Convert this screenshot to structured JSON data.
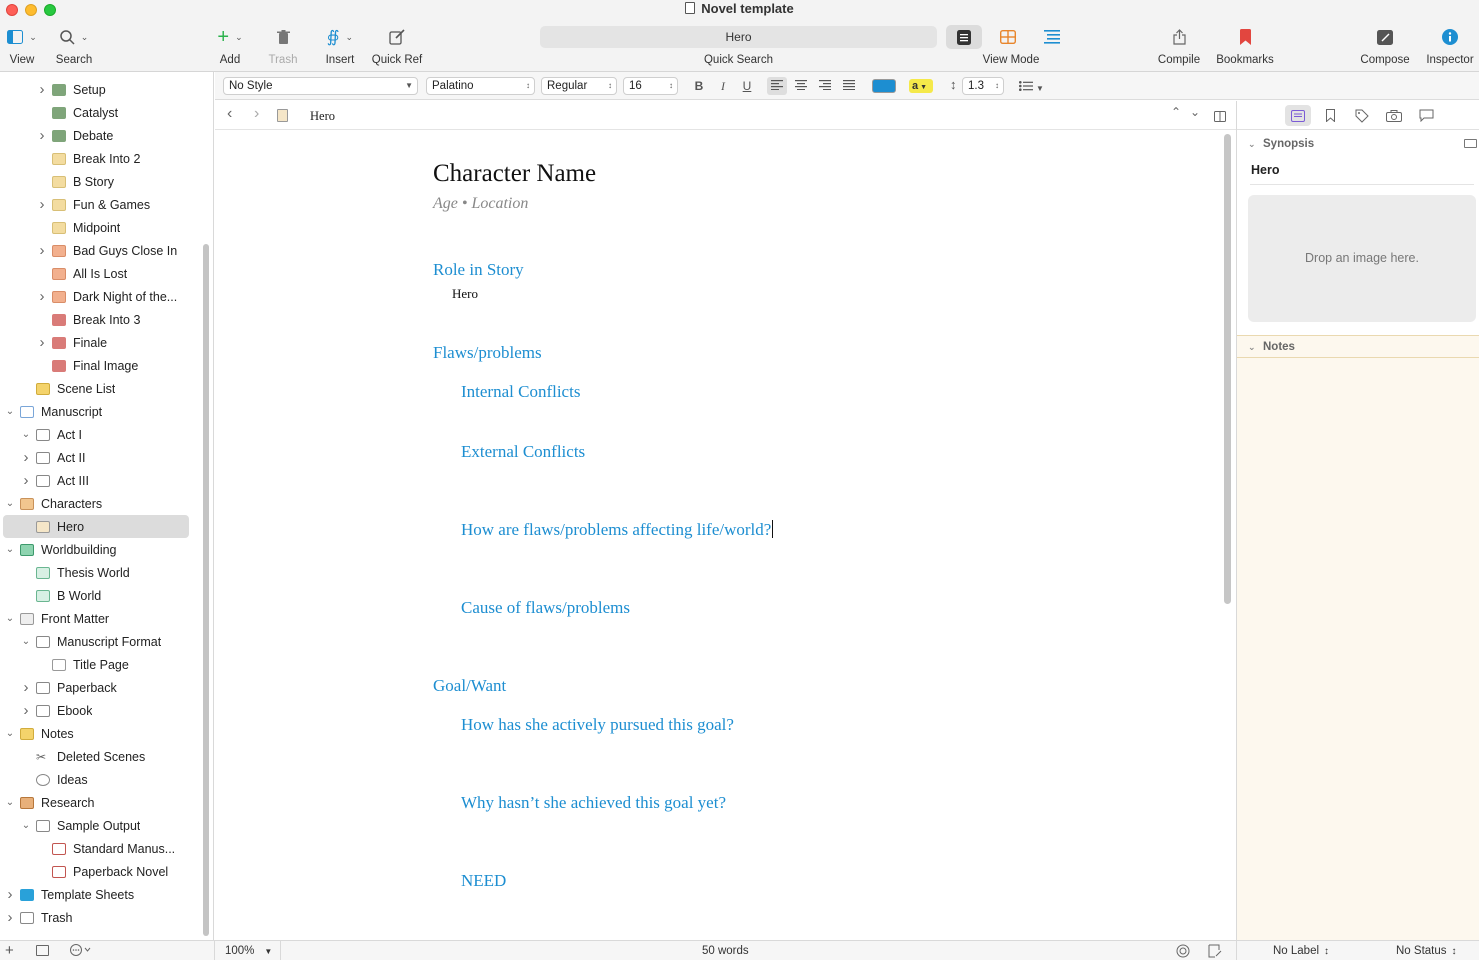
{
  "window": {
    "title": "Novel template"
  },
  "toolbar": {
    "view": "View",
    "search": "Search",
    "add": "Add",
    "trash": "Trash",
    "insert": "Insert",
    "quick_ref": "Quick Ref",
    "quick_search_value": "Hero",
    "quick_search_label": "Quick Search",
    "view_mode": "View Mode",
    "compile": "Compile",
    "bookmarks": "Bookmarks",
    "compose": "Compose",
    "inspector": "Inspector"
  },
  "binder": {
    "items": [
      {
        "label": "Setup",
        "has_children": true,
        "expanded": false
      },
      {
        "label": "Catalyst",
        "has_children": false
      },
      {
        "label": "Debate",
        "has_children": true,
        "expanded": false
      },
      {
        "label": "Break Into 2",
        "has_children": false
      },
      {
        "label": "B Story",
        "has_children": false
      },
      {
        "label": "Fun & Games",
        "has_children": true,
        "expanded": false
      },
      {
        "label": "Midpoint",
        "has_children": false
      },
      {
        "label": "Bad Guys Close In",
        "has_children": true,
        "expanded": false
      },
      {
        "label": "All Is Lost",
        "has_children": false
      },
      {
        "label": "Dark Night of the...",
        "has_children": true,
        "expanded": false
      },
      {
        "label": "Break Into 3",
        "has_children": false
      },
      {
        "label": "Finale",
        "has_children": true,
        "expanded": false
      },
      {
        "label": "Final Image",
        "has_children": false
      },
      {
        "label": "Scene List",
        "has_children": false
      },
      {
        "label": "Manuscript",
        "has_children": true,
        "expanded": true
      },
      {
        "label": "Act I",
        "has_children": true,
        "expanded": true
      },
      {
        "label": "Act II",
        "has_children": true,
        "expanded": false
      },
      {
        "label": "Act III",
        "has_children": true,
        "expanded": false
      },
      {
        "label": "Characters",
        "has_children": true,
        "expanded": true
      },
      {
        "label": "Hero",
        "has_children": false,
        "selected": true
      },
      {
        "label": "Worldbuilding",
        "has_children": true,
        "expanded": true
      },
      {
        "label": "Thesis World",
        "has_children": false
      },
      {
        "label": "B World",
        "has_children": false
      },
      {
        "label": "Front Matter",
        "has_children": true,
        "expanded": true
      },
      {
        "label": "Manuscript Format",
        "has_children": true,
        "expanded": true
      },
      {
        "label": "Title Page",
        "has_children": false
      },
      {
        "label": "Paperback",
        "has_children": true,
        "expanded": false
      },
      {
        "label": "Ebook",
        "has_children": true,
        "expanded": false
      },
      {
        "label": "Notes",
        "has_children": true,
        "expanded": true
      },
      {
        "label": "Deleted Scenes",
        "has_children": false
      },
      {
        "label": "Ideas",
        "has_children": false
      },
      {
        "label": "Research",
        "has_children": true,
        "expanded": true
      },
      {
        "label": "Sample Output",
        "has_children": true,
        "expanded": true
      },
      {
        "label": "Standard Manus...",
        "has_children": false
      },
      {
        "label": "Paperback Novel",
        "has_children": false
      },
      {
        "label": "Template Sheets",
        "has_children": true,
        "expanded": false
      },
      {
        "label": "Trash",
        "has_children": true,
        "expanded": false
      }
    ]
  },
  "format": {
    "style": "No Style",
    "font": "Palatino",
    "weight": "Regular",
    "size": "16",
    "bold": "B",
    "italic": "I",
    "underline": "U",
    "highlight": "a",
    "line_spacing": "1.3",
    "text_color": "#1d8ed1",
    "highlight_color": "#f5e94a"
  },
  "header": {
    "title": "Hero"
  },
  "document": {
    "title": "Character Name",
    "subtitle": "Age • Location",
    "role_heading": "Role in Story",
    "role_value": "Hero",
    "flaws_heading": "Flaws/problems",
    "internal": "Internal Conflicts",
    "external": "External Conflicts",
    "affecting": "How are flaws/problems affecting life/world?",
    "cause": "Cause of flaws/problems",
    "goal_heading": "Goal/Want",
    "pursued": "How has she actively pursued this goal?",
    "why_not": "Why hasn’t she achieved this goal yet?",
    "need": "NEED"
  },
  "inspector": {
    "synopsis_label": "Synopsis",
    "synopsis_title": "Hero",
    "drop_image": "Drop an image here.",
    "notes_label": "Notes"
  },
  "footer": {
    "zoom": "100%",
    "word_count": "50 words",
    "label": "No Label",
    "status": "No Status"
  }
}
